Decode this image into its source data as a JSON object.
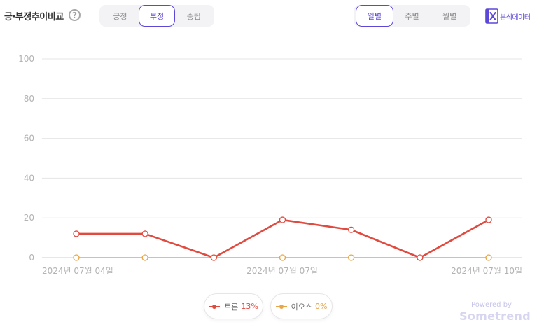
{
  "header": {
    "title": "긍·부정추이비교",
    "help_label": "?",
    "sentiment_tabs": [
      {
        "label": "긍정",
        "active": false
      },
      {
        "label": "부정",
        "active": true
      },
      {
        "label": "중립",
        "active": false
      }
    ],
    "period_tabs": [
      {
        "label": "일별",
        "active": true
      },
      {
        "label": "주별",
        "active": false
      },
      {
        "label": "월별",
        "active": false
      }
    ],
    "export_label": "분석데이터",
    "export_icon": "excel-x-icon"
  },
  "colors": {
    "accent": "#5b48d9",
    "series_1": "#e14a3f",
    "series_2": "#e7a64a",
    "grid": "#e4e4e4",
    "tick": "#b3b3b3"
  },
  "chart_data": {
    "type": "line",
    "x": [
      "2024년 07월 04일",
      "2024년 07월 05일",
      "2024년 07월 06일",
      "2024년 07월 07일",
      "2024년 07월 08일",
      "2024년 07월 09일",
      "2024년 07월 10일"
    ],
    "x_tick_labels": [
      "2024년 07월 04일",
      "2024년 07월 07일",
      "2024년 07월 10일"
    ],
    "y_ticks": [
      0,
      20,
      40,
      60,
      80,
      100
    ],
    "ylim": [
      0,
      100
    ],
    "grid": true,
    "legend_position": "bottom",
    "series": [
      {
        "name": "트론",
        "percent": "13%",
        "color": "#e14a3f",
        "values": [
          12,
          12,
          0,
          19,
          14,
          0,
          19
        ]
      },
      {
        "name": "이오스",
        "percent": "0%",
        "color": "#e7a64a",
        "values": [
          0,
          0,
          0,
          0,
          0,
          0,
          0
        ]
      }
    ]
  },
  "branding": {
    "powered_by": "Powered by",
    "brand": "Sometrend"
  }
}
